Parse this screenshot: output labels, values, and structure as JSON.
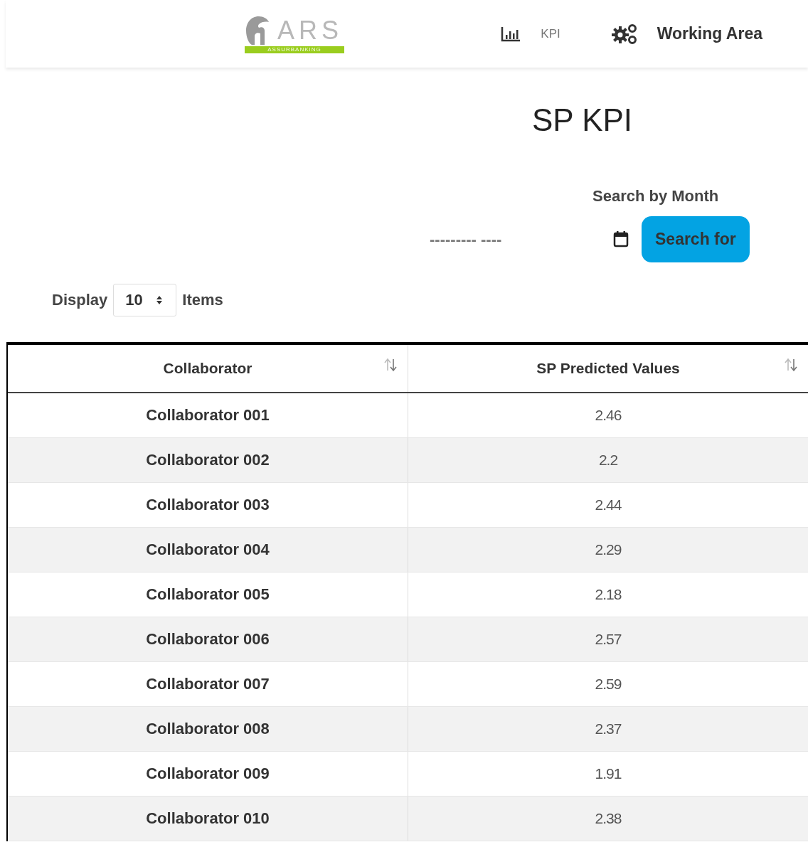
{
  "logo": {
    "name": "ARS",
    "tagline": "ASSURBANKING"
  },
  "nav": [
    {
      "kind": "chart",
      "label": "KPI",
      "selected": false
    },
    {
      "kind": "gears",
      "label": "Working Area",
      "selected": true
    }
  ],
  "title": "SP KPI",
  "search": {
    "label": "Search by Month",
    "placeholder": "--------- ----",
    "button": "Search for"
  },
  "page_size": {
    "before": "Display",
    "value": "10",
    "after": "Items"
  },
  "table": {
    "columns": [
      "Collaborator",
      "SP Predicted Values"
    ],
    "rows": [
      [
        "Collaborator 001",
        "2.46"
      ],
      [
        "Collaborator 002",
        "2.2"
      ],
      [
        "Collaborator 003",
        "2.44"
      ],
      [
        "Collaborator 004",
        "2.29"
      ],
      [
        "Collaborator 005",
        "2.18"
      ],
      [
        "Collaborator 006",
        "2.57"
      ],
      [
        "Collaborator 007",
        "2.59"
      ],
      [
        "Collaborator 008",
        "2.37"
      ],
      [
        "Collaborator 009",
        "1.91"
      ],
      [
        "Collaborator 010",
        "2.38"
      ]
    ]
  }
}
